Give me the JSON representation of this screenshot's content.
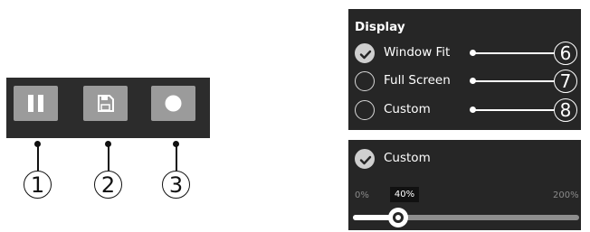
{
  "toolbar": {
    "buttons": [
      {
        "name": "pause",
        "icon": "pause-icon"
      },
      {
        "name": "save",
        "icon": "save-icon"
      },
      {
        "name": "record",
        "icon": "record-icon"
      }
    ],
    "callouts": [
      "1",
      "2",
      "3"
    ]
  },
  "display": {
    "title": "Display",
    "options": [
      {
        "label": "Window Fit",
        "checked": true,
        "callout": "6"
      },
      {
        "label": "Full Screen",
        "checked": false,
        "callout": "7"
      },
      {
        "label": "Custom",
        "checked": false,
        "callout": "8"
      }
    ]
  },
  "zoom": {
    "label": "Custom",
    "checked": true,
    "min_label": "0%",
    "max_label": "200%",
    "value_label": "40%",
    "value_percent": 40,
    "min": 0,
    "max": 200
  },
  "colors": {
    "panel_bg": "#262626",
    "toolbar_bg": "#2c2c2c",
    "button_bg": "#9b9b9b"
  }
}
